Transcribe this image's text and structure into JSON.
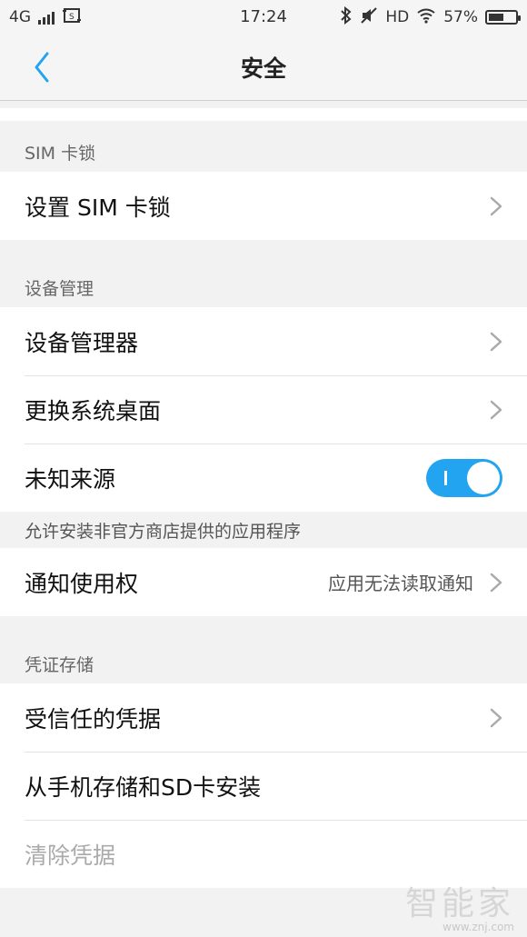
{
  "status_bar": {
    "network": "4G",
    "time": "17:24",
    "hd": "HD",
    "battery": "57%",
    "battery_level": 0.57
  },
  "header": {
    "title": "安全"
  },
  "sections": {
    "sim": {
      "header": "SIM 卡锁",
      "items": [
        {
          "label": "设置 SIM 卡锁"
        }
      ]
    },
    "device": {
      "header": "设备管理",
      "items": [
        {
          "label": "设备管理器"
        },
        {
          "label": "更换系统桌面"
        },
        {
          "label": "未知来源",
          "toggle_on": true
        }
      ],
      "unknown_source_desc": "允许安装非官方商店提供的应用程序"
    },
    "notify": {
      "label": "通知使用权",
      "value": "应用无法读取通知"
    },
    "credentials": {
      "header": "凭证存储",
      "items": [
        {
          "label": "受信任的凭据"
        },
        {
          "label": "从手机存储和SD卡安装"
        },
        {
          "label": "清除凭据",
          "disabled": true
        }
      ]
    }
  },
  "watermark": {
    "text": "智能家",
    "url": "www.znj.com"
  },
  "colors": {
    "accent": "#22a4f1",
    "background": "#f2f2f2"
  }
}
